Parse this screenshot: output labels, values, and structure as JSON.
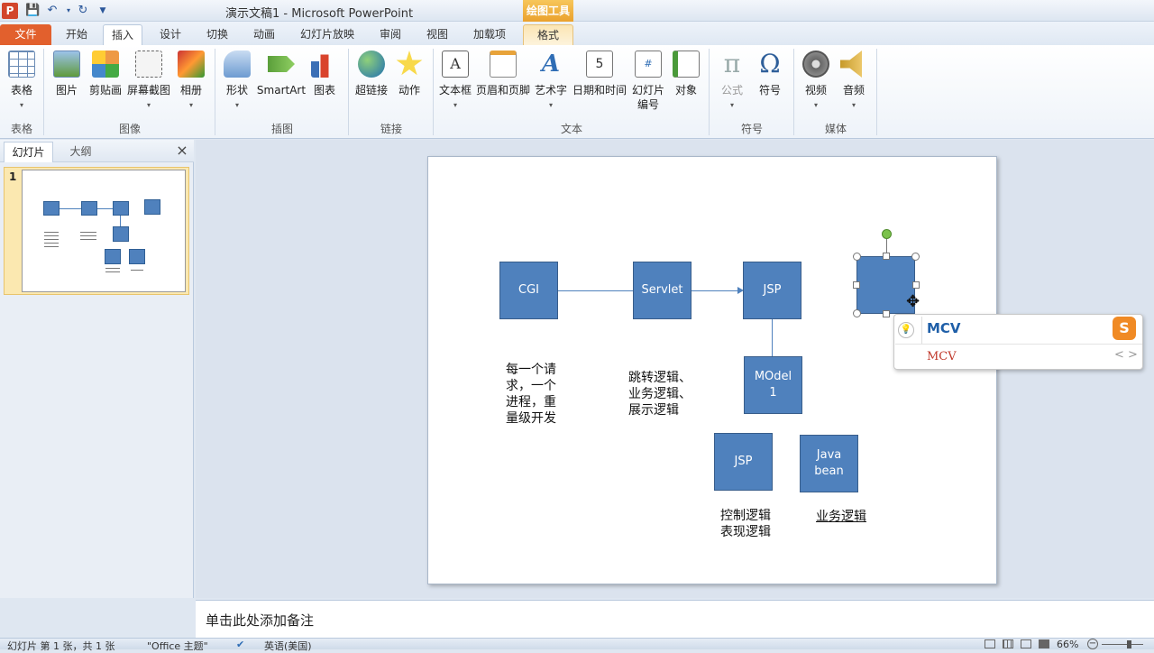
{
  "titlebar": {
    "title": "演示文稿1 - Microsoft PowerPoint",
    "context_tab_group": "绘图工具"
  },
  "tabs": [
    "文件",
    "开始",
    "插入",
    "设计",
    "切换",
    "动画",
    "幻灯片放映",
    "审阅",
    "视图",
    "加载项",
    "格式"
  ],
  "ribbon": {
    "tables": {
      "label": "表格",
      "buttons": [
        "表格"
      ]
    },
    "images": {
      "label": "图像",
      "buttons": [
        "图片",
        "剪贴画",
        "屏幕截图",
        "相册"
      ]
    },
    "illustrations": {
      "label": "插图",
      "buttons": [
        "形状",
        "SmartArt",
        "图表"
      ]
    },
    "links": {
      "label": "链接",
      "buttons": [
        "超链接",
        "动作"
      ]
    },
    "text": {
      "label": "文本",
      "buttons": [
        "文本框",
        "页眉和页脚",
        "艺术字",
        "日期和时间",
        "幻灯片",
        "对象"
      ],
      "slide_number_line2": "编号"
    },
    "symbols": {
      "label": "符号",
      "buttons": [
        "公式",
        "符号"
      ]
    },
    "media": {
      "label": "媒体",
      "buttons": [
        "视频",
        "音频"
      ]
    }
  },
  "panel": {
    "tab_slides": "幻灯片",
    "tab_outline": "大纲",
    "slide_number": "1"
  },
  "slide": {
    "boxes": {
      "cgi": "CGI",
      "servlet": "Servlet",
      "jsp_top": "JSP",
      "model1": "MOdel\n1",
      "jsp_bottom": "JSP",
      "javabean": "Java\nbean"
    },
    "captions": {
      "cgi": "每一个请\n求，一个\n进程，重\n量级开发",
      "servlet": "跳转逻辑、\n业务逻辑、\n展示逻辑",
      "jsp_bottom": "控制逻辑\n表现逻辑",
      "javabean": "业务逻辑"
    }
  },
  "ime": {
    "input": "MCV",
    "candidate": "MCV",
    "nav": "< >"
  },
  "notes": {
    "placeholder": "单击此处添加备注"
  },
  "statusbar": {
    "slide_info": "幻灯片 第 1 张，共 1 张",
    "theme": "\"Office 主题\"",
    "language": "英语(美国)",
    "zoom": "66%"
  },
  "colors": {
    "shape_fill": "#4f81bd",
    "file_tab": "#e2602d",
    "context_tab": "#eaa12d"
  }
}
